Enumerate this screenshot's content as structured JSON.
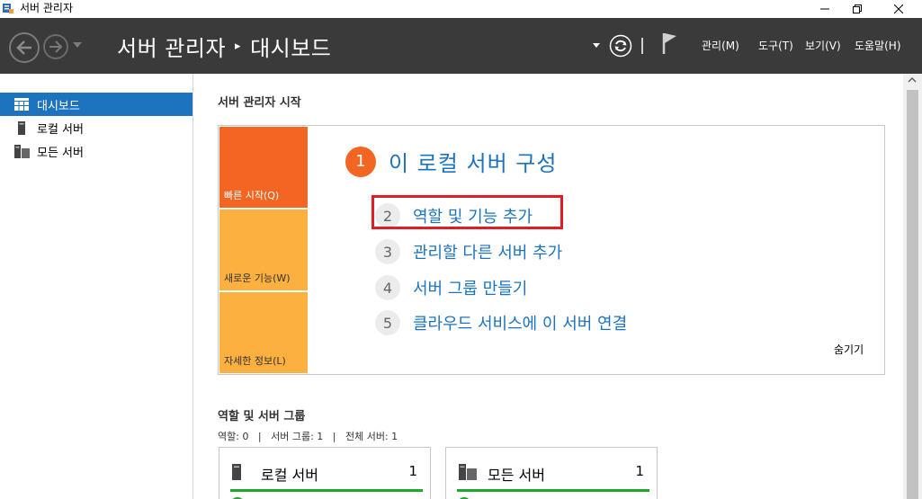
{
  "window": {
    "title": "서버 관리자",
    "accent": "#1e73be"
  },
  "header": {
    "breadcrumb_app": "서버 관리자",
    "breadcrumb_page": "대시보드",
    "separator": "▸",
    "menus": [
      "관리(M)",
      "도구(T)",
      "보기(V)",
      "도움말(H)"
    ]
  },
  "sidebar": {
    "items": [
      {
        "label": "대시보드",
        "icon": "dashboard-icon",
        "active": true
      },
      {
        "label": "로컬 서버",
        "icon": "server-icon",
        "active": false
      },
      {
        "label": "모든 서버",
        "icon": "servers-icon",
        "active": false
      }
    ]
  },
  "main": {
    "welcome_title": "서버 관리자 시작",
    "tiles": [
      "빠른 시작(Q)",
      "새로운 기능(W)",
      "자세한 정보(L)"
    ],
    "steps": [
      {
        "num": "1",
        "label": "이 로컬 서버 구성"
      },
      {
        "num": "2",
        "label": "역할 및 기능 추가"
      },
      {
        "num": "3",
        "label": "관리할 다른 서버 추가"
      },
      {
        "num": "4",
        "label": "서버 그룹 만들기"
      },
      {
        "num": "5",
        "label": "클라우드 서비스에 이 서버 연결"
      }
    ],
    "hide_label": "숨기기",
    "roles_title": "역할 및 서버 그룹",
    "summary": "역할: 0   |   서버 그룹: 1   |   전체 서버: 1",
    "cards": [
      {
        "title": "로컬 서버",
        "count": "1"
      },
      {
        "title": "모든 서버",
        "count": "1"
      }
    ]
  }
}
